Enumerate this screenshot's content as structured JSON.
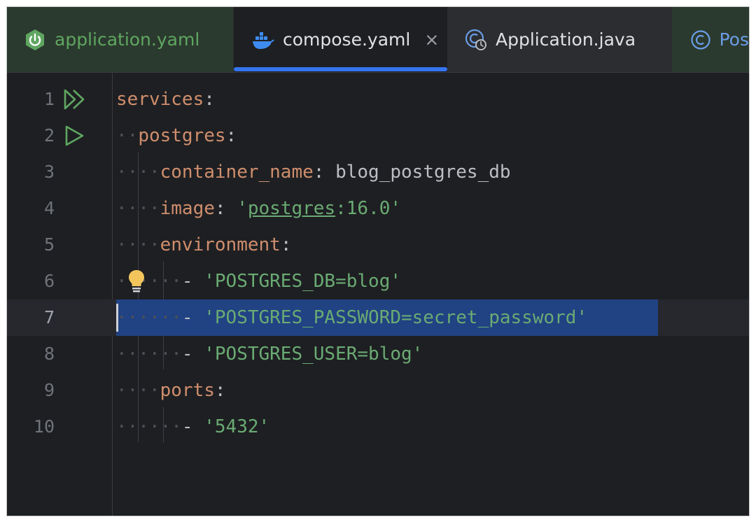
{
  "tabs": [
    {
      "label": "application.yaml",
      "icon": "spring-boot-icon",
      "state": "inactive"
    },
    {
      "label": "compose.yaml",
      "icon": "docker-icon",
      "state": "active",
      "close": "×"
    },
    {
      "label": "Application.java",
      "icon": "java-class-run-icon",
      "state": "inactive"
    },
    {
      "label": "Pos",
      "icon": "java-class-icon",
      "state": "inactive-truncated"
    }
  ],
  "editor": {
    "current_line": 7,
    "selected_line": 7,
    "lines": [
      {
        "num": "1",
        "indent": "",
        "key": "services",
        "colon": ":",
        "value": "",
        "gutter": "run-all-icon"
      },
      {
        "num": "2",
        "indent": "··",
        "key": "postgres",
        "colon": ":",
        "value": "",
        "gutter": "run-icon"
      },
      {
        "num": "3",
        "indent": "····",
        "key": "container_name",
        "colon": ": ",
        "value": "blog_postgres_db"
      },
      {
        "num": "4",
        "indent": "····",
        "key": "image",
        "colon": ": ",
        "value_q1": "'",
        "value_u": "postgres",
        "value_rest": ":16.0'"
      },
      {
        "num": "5",
        "indent": "····",
        "key": "environment",
        "colon": ":",
        "value": ""
      },
      {
        "num": "6",
        "indent": "······",
        "dash": "- ",
        "value": "'POSTGRES_DB=blog'",
        "gutter": "lightbulb-icon"
      },
      {
        "num": "7",
        "indent": "······",
        "dash": "- ",
        "value": "'POSTGRES_PASSWORD=secret_password'"
      },
      {
        "num": "8",
        "indent": "······",
        "dash": "- ",
        "value": "'POSTGRES_USER=blog'"
      },
      {
        "num": "9",
        "indent": "····",
        "key": "ports",
        "colon": ":",
        "value": ""
      },
      {
        "num": "10",
        "indent": "······",
        "dash": "- ",
        "value": "'5432'"
      }
    ]
  },
  "colors": {
    "background": "#1e1f22",
    "keyword": "#cf8e6d",
    "string": "#6aab73",
    "selection": "#214283",
    "accent": "#3574f0"
  }
}
